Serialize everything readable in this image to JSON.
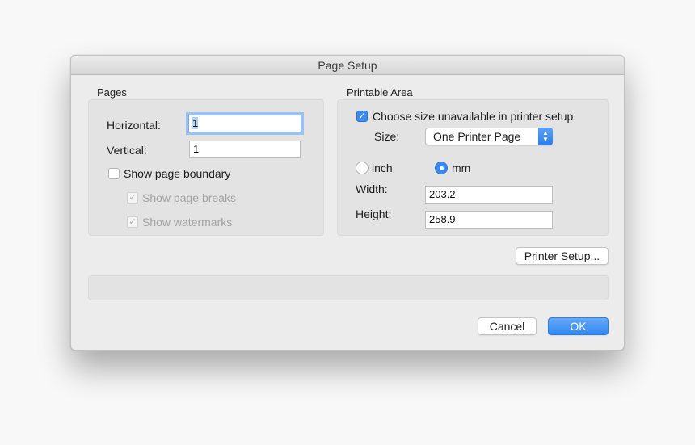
{
  "window": {
    "title": "Page Setup"
  },
  "pages": {
    "group_label": "Pages",
    "horizontal_label": "Horizontal:",
    "horizontal_value": "1",
    "vertical_label": "Vertical:",
    "vertical_value": "1",
    "show_page_boundary": {
      "label": "Show page boundary",
      "checked": false
    },
    "show_page_breaks": {
      "label": "Show page breaks",
      "checked": true,
      "enabled": false
    },
    "show_watermarks": {
      "label": "Show watermarks",
      "checked": true,
      "enabled": false
    }
  },
  "printable_area": {
    "group_label": "Printable Area",
    "choose_size": {
      "label": "Choose size unavailable in printer setup",
      "checked": true
    },
    "size_label": "Size:",
    "size_value": "One Printer Page",
    "unit_inch": "inch",
    "unit_mm": "mm",
    "selected_unit": "mm",
    "width_label": "Width:",
    "width_value": "203.2",
    "height_label": "Height:",
    "height_value": "258.9"
  },
  "buttons": {
    "printer_setup": "Printer Setup...",
    "cancel": "Cancel",
    "ok": "OK"
  },
  "colors": {
    "accent": "#3b8bee"
  },
  "icons": {
    "checkmark": "checkmark-icon",
    "stepper": "popup-stepper-icon"
  }
}
